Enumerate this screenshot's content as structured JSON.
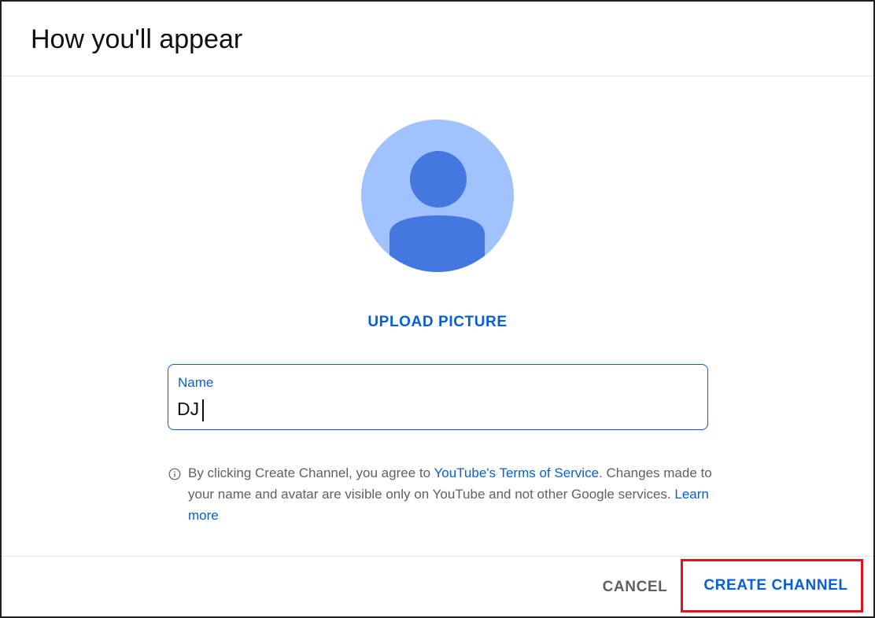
{
  "dialog": {
    "title": "How you'll appear"
  },
  "avatar": {
    "icon": "default-person-avatar",
    "bg_color": "#a0c3ff",
    "fg_color": "#4477e0"
  },
  "upload": {
    "label": "UPLOAD PICTURE"
  },
  "name_field": {
    "label": "Name",
    "value": "DJ"
  },
  "info": {
    "icon": "info-icon",
    "text_before": "By clicking Create Channel, you agree to ",
    "terms_link": "YouTube's Terms of Service",
    "text_after": ". Changes made to your name and avatar are visible only on YouTube and not other Google services. ",
    "learn_more_link": "Learn more"
  },
  "footer": {
    "cancel_label": "CANCEL",
    "create_label": "CREATE CHANNEL"
  },
  "colors": {
    "accent": "#065fd4",
    "highlight_border": "#e0141e"
  }
}
